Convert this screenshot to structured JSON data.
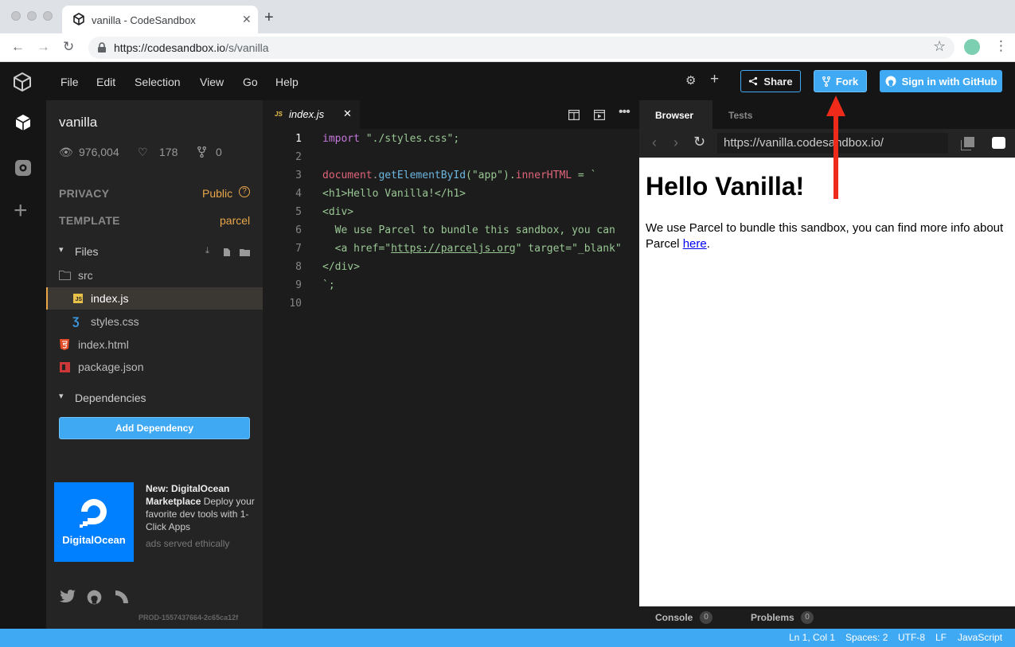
{
  "browser": {
    "tab_title": "vanilla - CodeSandbox",
    "url_host": "https://codesandbox.io",
    "url_path": "/s/vanilla"
  },
  "menu": [
    "File",
    "Edit",
    "Selection",
    "View",
    "Go",
    "Help"
  ],
  "header": {
    "share_label": "Share",
    "fork_label": "Fork",
    "signin_label": "Sign in with GitHub"
  },
  "sandbox": {
    "name": "vanilla",
    "views": "976,004",
    "likes": "178",
    "forks": "0",
    "privacy_label": "PRIVACY",
    "privacy_value": "Public",
    "template_label": "TEMPLATE",
    "template_value": "parcel"
  },
  "files": {
    "section_label": "Files",
    "items": [
      "src",
      "index.js",
      "styles.css",
      "index.html",
      "package.json"
    ]
  },
  "dependencies": {
    "section_label": "Dependencies",
    "add_label": "Add Dependency"
  },
  "ad": {
    "brand": "DigitalOcean",
    "headline": "New: DigitalOcean Marketplace",
    "body": "Deploy your favorite dev tools with 1-Click Apps",
    "footer": "ads served ethically"
  },
  "build_id": "PROD-1557437664-2c65ca12f",
  "editor": {
    "tab_label": "index.js",
    "tab_lang": "JS",
    "line_numbers": [
      "1",
      "2",
      "3",
      "4",
      "5",
      "6",
      "7",
      "8",
      "9",
      "10"
    ],
    "code": {
      "l1_kw": "import",
      "l1_str": " \"./styles.css\";",
      "l3_a": "document",
      "l3_b": ".",
      "l3_c": "getElementById",
      "l3_d": "(\"app\").",
      "l3_e": "innerHTML",
      "l3_f": " = `",
      "l4": "<h1>Hello Vanilla!</h1>",
      "l5": "<div>",
      "l6": "  We use Parcel to bundle this sandbox, you can",
      "l7_a": "  <a href=\"",
      "l7_b": "https://parceljs.org",
      "l7_c": "\" target=\"_blank\"",
      "l8": "</div>",
      "l9": "`;"
    }
  },
  "preview": {
    "tab_browser": "Browser",
    "tab_tests": "Tests",
    "url": "https://vanilla.codesandbox.io/",
    "heading": "Hello Vanilla!",
    "para_text": "We use Parcel to bundle this sandbox, you can find more info about Parcel ",
    "para_link": "here",
    "para_end": ".",
    "console_label": "Console",
    "console_count": "0",
    "problems_label": "Problems",
    "problems_count": "0"
  },
  "status": {
    "position": "Ln 1, Col 1",
    "spaces": "Spaces: 2",
    "encoding": "UTF-8",
    "eol": "LF",
    "language": "JavaScript"
  },
  "colors": {
    "accent": "#40a9f3",
    "annotation_arrow": "#ee2a1b"
  }
}
